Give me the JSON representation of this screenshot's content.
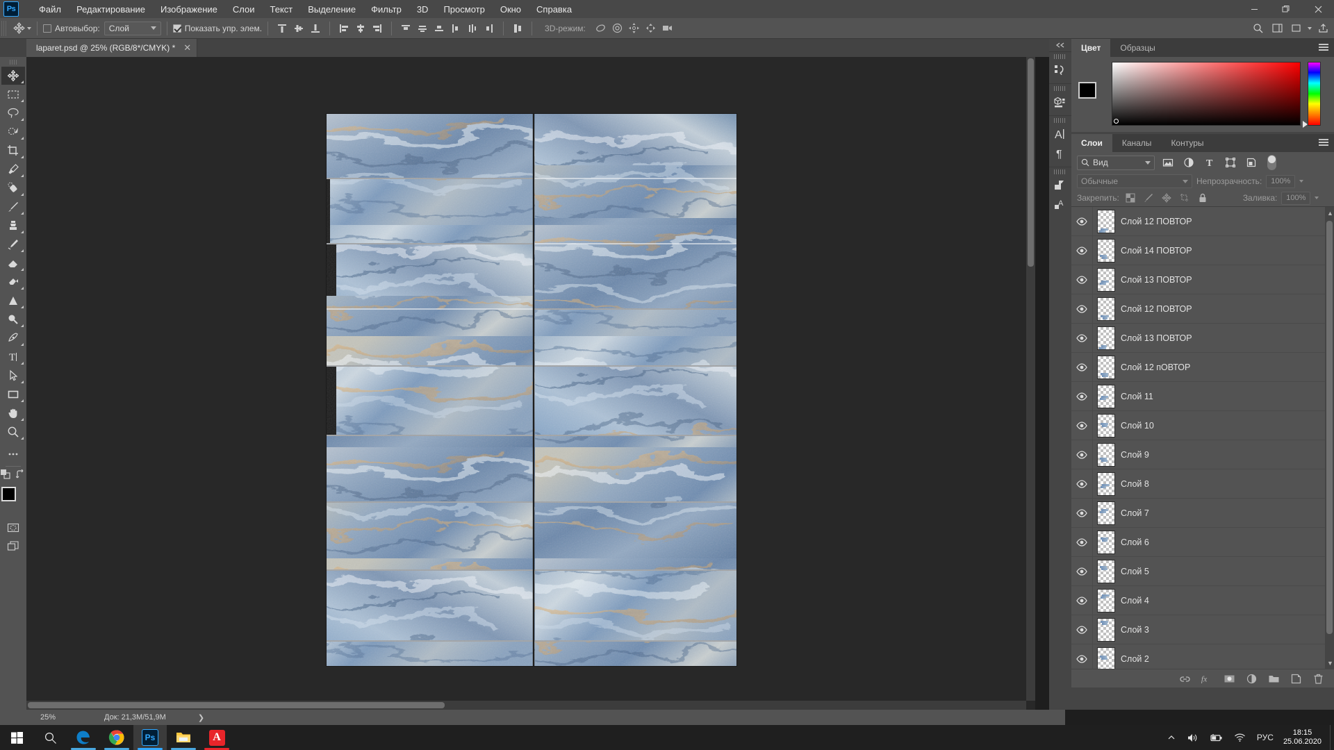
{
  "app": {
    "name": "Ps",
    "logo_label": "Ps"
  },
  "window_controls": {
    "minimize": "—",
    "maximize": "❐",
    "close": "✕"
  },
  "menubar": {
    "items": [
      {
        "label": "Файл"
      },
      {
        "label": "Редактирование"
      },
      {
        "label": "Изображение"
      },
      {
        "label": "Слои"
      },
      {
        "label": "Текст"
      },
      {
        "label": "Выделение"
      },
      {
        "label": "Фильтр"
      },
      {
        "label": "3D"
      },
      {
        "label": "Просмотр"
      },
      {
        "label": "Окно"
      },
      {
        "label": "Справка"
      }
    ]
  },
  "options_bar": {
    "tool_icon": "move-tool-icon",
    "auto_select_label": "Автовыбор:",
    "auto_select_checked": false,
    "auto_select_value": "Слой",
    "show_controls_label": "Показать упр. элем.",
    "show_controls_checked": true,
    "align_group_1": [
      "align-top-edges-icon",
      "align-vertical-centers-icon",
      "align-bottom-edges-icon"
    ],
    "align_group_2": [
      "align-left-edges-icon",
      "align-horizontal-centers-icon",
      "align-right-edges-icon"
    ],
    "distribute_group_1": [
      "distribute-top-edges-icon",
      "distribute-vertical-centers-icon",
      "distribute-bottom-edges-icon"
    ],
    "distribute_group_2": [
      "distribute-left-edges-icon",
      "distribute-horizontal-centers-icon",
      "distribute-right-edges-icon"
    ],
    "extra_icon": "distribute-spacing-icon",
    "mode_3d_label": "3D-режим:",
    "mode_3d_icons": [
      "rotate-3d-icon",
      "roll-3d-icon",
      "pan-3d-icon",
      "slide-3d-icon",
      "scale-3d-icon"
    ],
    "right_icons": [
      "search-icon",
      "workspace-icon",
      "arrange-icon",
      "share-icon"
    ]
  },
  "document_tab": {
    "title": "laparet.psd @ 25% (RGB/8*/CMYK) *",
    "close_label": "✕"
  },
  "toolbar": {
    "tools": [
      {
        "name": "move-tool",
        "glyph": "✥",
        "active": true
      },
      {
        "name": "rectangular-marquee-tool",
        "glyph": "▭",
        "active": false
      },
      {
        "name": "lasso-tool",
        "glyph": "◯",
        "active": false
      },
      {
        "name": "quick-selection-tool",
        "glyph": "✦",
        "active": false
      },
      {
        "name": "crop-tool",
        "glyph": "⌗",
        "active": false
      },
      {
        "name": "eyedropper-tool",
        "glyph": "⚲",
        "active": false
      },
      {
        "name": "spot-healing-brush-tool",
        "glyph": "✎",
        "active": false
      },
      {
        "name": "brush-tool",
        "glyph": "🖌",
        "active": false
      },
      {
        "name": "clone-stamp-tool",
        "glyph": "⎙",
        "active": false
      },
      {
        "name": "history-brush-tool",
        "glyph": "✑",
        "active": false
      },
      {
        "name": "eraser-tool",
        "glyph": "◣",
        "active": false
      },
      {
        "name": "gradient-tool",
        "glyph": "▤",
        "active": false
      },
      {
        "name": "blur-tool",
        "glyph": "▲",
        "active": false
      },
      {
        "name": "dodge-tool",
        "glyph": "◉",
        "active": false
      },
      {
        "name": "pen-tool",
        "glyph": "✒",
        "active": false
      },
      {
        "name": "type-tool",
        "glyph": "T",
        "active": false
      },
      {
        "name": "path-selection-tool",
        "glyph": "➤",
        "active": false
      },
      {
        "name": "rectangle-tool",
        "glyph": "▬",
        "active": false
      },
      {
        "name": "hand-tool",
        "glyph": "✋",
        "active": false
      },
      {
        "name": "zoom-tool",
        "glyph": "🔍",
        "active": false
      },
      {
        "name": "edit-toolbar",
        "glyph": "•••",
        "active": false
      }
    ],
    "foreground_color": "#000000",
    "background_color": "#ffffff",
    "quick_mask_name": "quick-mask-mode",
    "screen_mode_name": "screen-mode"
  },
  "canvas": {
    "background_color": "#282828",
    "artboard_color": "#c9cdd2",
    "tiles_note": "blue marble porcelain tile mockup, staggered brick layout"
  },
  "status_bar": {
    "zoom": "25%",
    "doc_info": "Док: 21,3M/51,9M",
    "chevron": "❯"
  },
  "dock_icons": [
    {
      "name": "history-panel-icon",
      "glyph": "⟲"
    },
    {
      "name": "3d-panel-icon",
      "glyph": "⬚"
    },
    {
      "name": "character-panel-icon",
      "glyph": "A"
    },
    {
      "name": "paragraph-panel-icon",
      "glyph": "¶"
    },
    {
      "name": "layer-comps-panel-icon",
      "glyph": "◱"
    },
    {
      "name": "styles-panel-icon",
      "glyph": "A"
    }
  ],
  "color_panel": {
    "tabs": [
      {
        "label": "Цвет",
        "active": true
      },
      {
        "label": "Образцы",
        "active": false
      }
    ],
    "foreground": "#000000",
    "background": "#ffffff",
    "ramp_base_color": "#ff0000"
  },
  "layers_panel": {
    "tabs": [
      {
        "label": "Слои",
        "active": true
      },
      {
        "label": "Каналы",
        "active": false
      },
      {
        "label": "Контуры",
        "active": false
      }
    ],
    "filter": {
      "icon": "search-icon",
      "value": "Вид",
      "type_icons": [
        {
          "name": "filter-pixel-icon",
          "glyph": "▣"
        },
        {
          "name": "filter-adjustment-icon",
          "glyph": "◑"
        },
        {
          "name": "filter-type-icon",
          "glyph": "T"
        },
        {
          "name": "filter-shape-icon",
          "glyph": "⛶"
        },
        {
          "name": "filter-smart-object-icon",
          "glyph": "◰"
        }
      ],
      "toggle_on": true
    },
    "blend_mode": "Обычные",
    "opacity_label": "Непрозрачность:",
    "opacity_value": "100%",
    "lock_label": "Закрепить:",
    "lock_icons": [
      {
        "name": "lock-transparent-pixels-icon",
        "glyph": "▨"
      },
      {
        "name": "lock-image-pixels-icon",
        "glyph": "🖌"
      },
      {
        "name": "lock-position-icon",
        "glyph": "✥"
      },
      {
        "name": "lock-artboard-nesting-icon",
        "glyph": "⌗"
      },
      {
        "name": "lock-all-icon",
        "glyph": "🔒"
      }
    ],
    "fill_label": "Заливка:",
    "fill_value": "100%",
    "layers": [
      {
        "name": "Слой 12 ПОВТОР",
        "visible": true
      },
      {
        "name": "Слой 14 ПОВТОР",
        "visible": true
      },
      {
        "name": "Слой 13 ПОВТОР",
        "visible": true
      },
      {
        "name": "Слой 12 ПОВТОР",
        "visible": true
      },
      {
        "name": "Слой 13 ПОВТОР",
        "visible": true
      },
      {
        "name": "Слой 12 пОВТОР",
        "visible": true
      },
      {
        "name": "Слой 11",
        "visible": true
      },
      {
        "name": "Слой 10",
        "visible": true
      },
      {
        "name": "Слой 9",
        "visible": true
      },
      {
        "name": "Слой 8",
        "visible": true
      },
      {
        "name": "Слой 7",
        "visible": true
      },
      {
        "name": "Слой 6",
        "visible": true
      },
      {
        "name": "Слой 5",
        "visible": true
      },
      {
        "name": "Слой 4",
        "visible": true
      },
      {
        "name": "Слой 3",
        "visible": true
      },
      {
        "name": "Слой 2",
        "visible": true
      }
    ],
    "footer_icons": [
      {
        "name": "link-layers-icon",
        "glyph": "⛓"
      },
      {
        "name": "layer-style-fx-icon",
        "glyph": "fx"
      },
      {
        "name": "add-layer-mask-icon",
        "glyph": "◉"
      },
      {
        "name": "new-adjustment-layer-icon",
        "glyph": "◑"
      },
      {
        "name": "new-group-icon",
        "glyph": "🗀"
      },
      {
        "name": "new-layer-icon",
        "glyph": "🗋"
      },
      {
        "name": "delete-layer-icon",
        "glyph": "🗑"
      }
    ]
  },
  "taskbar": {
    "start_label": "start-button",
    "search_label": "search-button",
    "apps": [
      {
        "name": "edge",
        "glyph": "e",
        "color": "#0e7ec8",
        "underline": "#4aa8e0",
        "active": false
      },
      {
        "name": "chrome",
        "glyph": "◉",
        "color": "#4285f4",
        "underline": "#4aa8e0",
        "active": false
      },
      {
        "name": "photoshop",
        "glyph": "Ps",
        "color": "#31a8ff",
        "underline": "#31a8ff",
        "active": true
      },
      {
        "name": "file-explorer",
        "glyph": "🗀",
        "color": "#ffc83d",
        "underline": "#4aa8e0",
        "active": false
      },
      {
        "name": "acrobat-reader",
        "glyph": "A",
        "color": "#e8252a",
        "underline": "#e8252a",
        "active": false
      }
    ],
    "tray": {
      "chevron": "⌃",
      "volume_icon": "volume-icon",
      "battery_icon": "battery-icon",
      "network_icon": "wifi-icon",
      "language": "РУС",
      "time": "18:15",
      "date": "25.06.2020"
    }
  }
}
